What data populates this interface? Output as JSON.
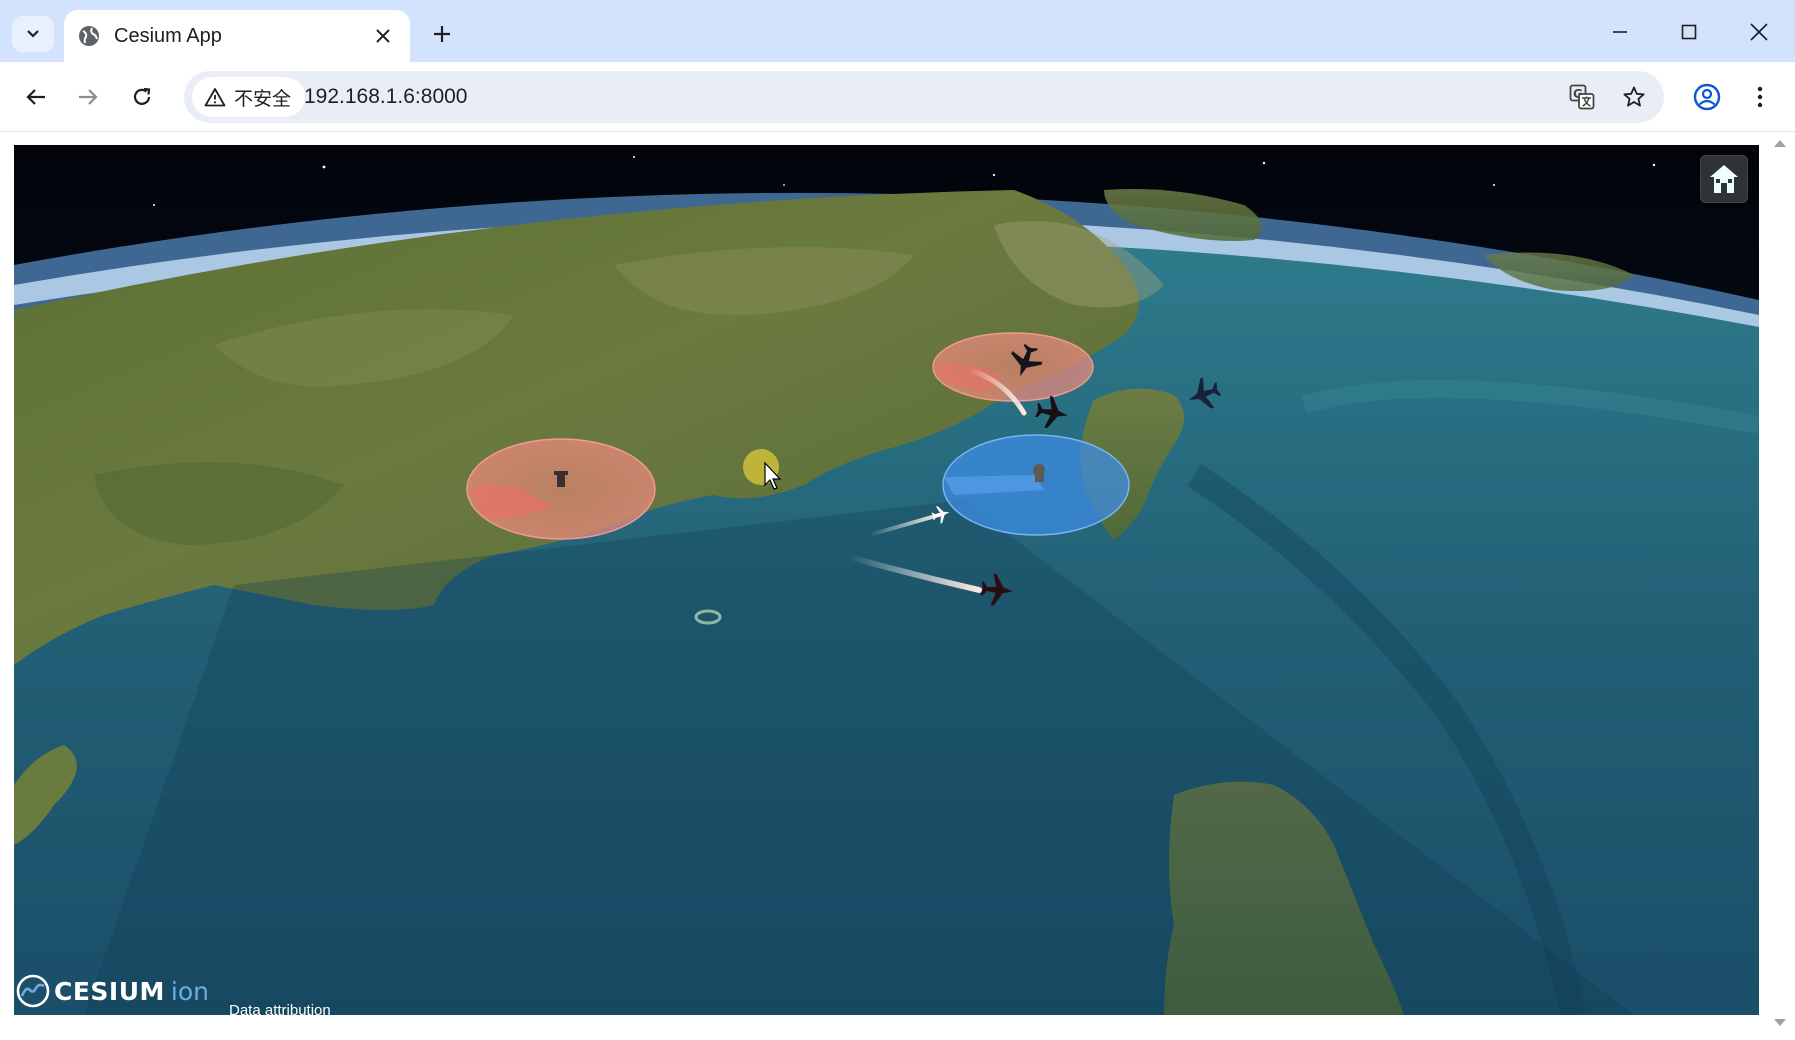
{
  "browser": {
    "tab_title": "Cesium App",
    "security_label": "不安全",
    "url": "192.168.1.6:8000",
    "icons": {
      "tab_menu": "chevron-down-icon",
      "favicon": "globe-icon",
      "tab_close": "close-icon",
      "new_tab": "plus-icon",
      "minimize": "minimize-icon",
      "maximize": "maximize-icon",
      "close_window": "close-icon",
      "back": "arrow-left-icon",
      "forward": "arrow-right-icon",
      "reload": "reload-icon",
      "warning": "warning-icon",
      "translate": "translate-icon",
      "bookmark": "star-icon",
      "profile": "profile-icon",
      "menu": "kebab-menu-icon"
    }
  },
  "viewer": {
    "logo_word": "CESIUM",
    "logo_ion": "ion",
    "attribution": "Data attribution",
    "home_icon": "home-icon",
    "overlay_colors": {
      "red_zone": "#f08080",
      "blue_zone": "#4a90e2"
    }
  }
}
